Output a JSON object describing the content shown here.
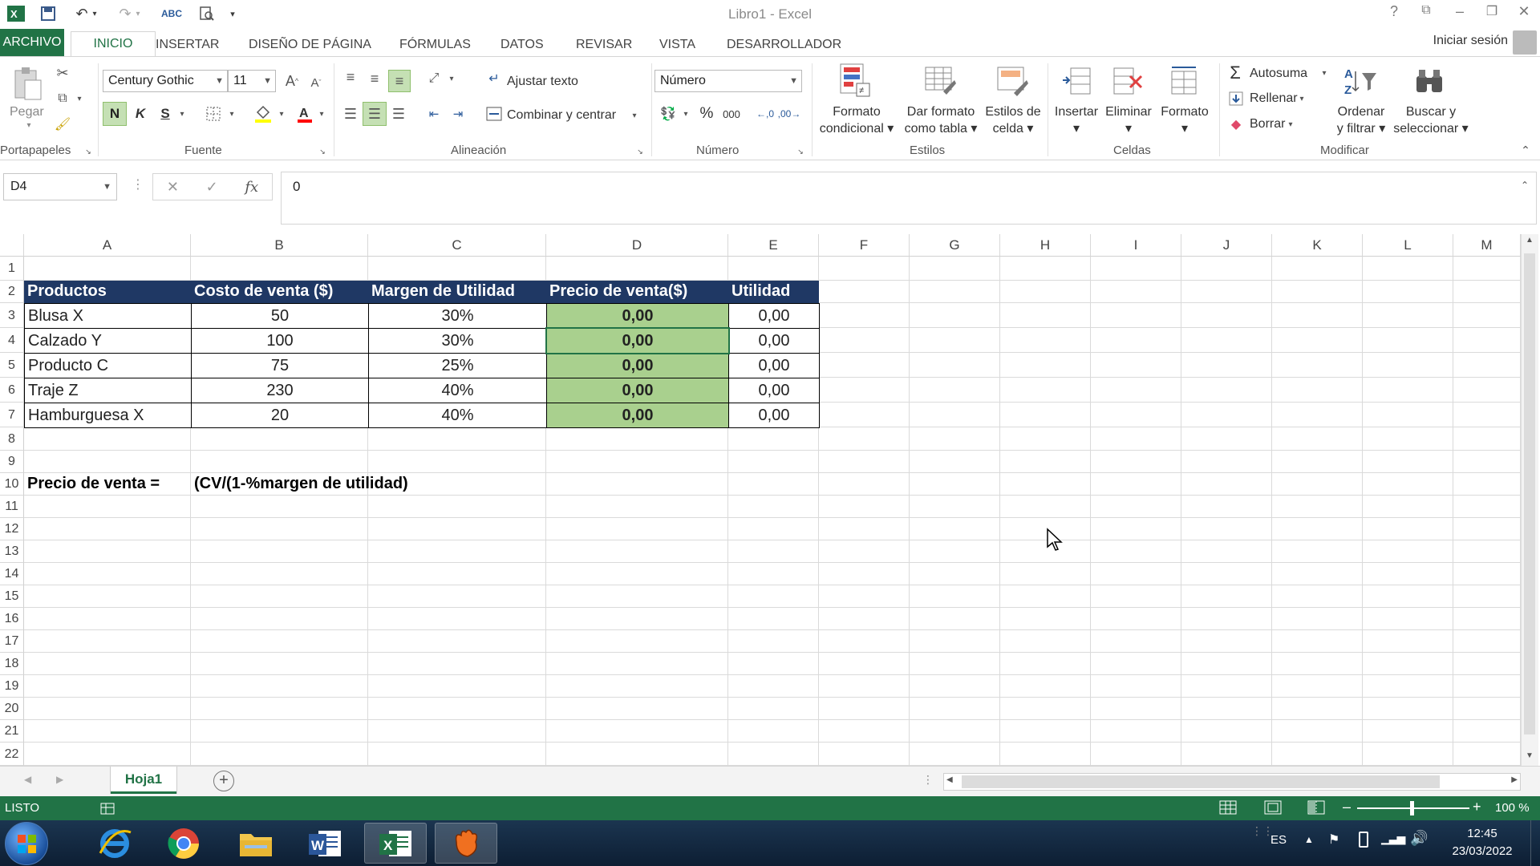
{
  "window": {
    "title": "Libro1 - Excel",
    "help": "?",
    "ribbon_display": "⧉",
    "minimize": "–",
    "restore": "❐",
    "close": "✕"
  },
  "qat": {
    "excel_icon": "excel-logo",
    "save": "save-icon",
    "undo": "undo-icon",
    "redo": "redo-icon",
    "spelling": "spelling-icon",
    "print_preview": "print-preview-icon",
    "customize": "▾"
  },
  "tabs": [
    "ARCHIVO",
    "INICIO",
    "INSERTAR",
    "DISEÑO DE PÁGINA",
    "FÓRMULAS",
    "DATOS",
    "REVISAR",
    "VISTA",
    "DESARROLLADOR"
  ],
  "signin": "Iniciar sesión",
  "ribbon": {
    "clipboard": {
      "paste": "Pegar",
      "label": "Portapapeles"
    },
    "font": {
      "name": "Century Gothic",
      "size": "11",
      "bold": "N",
      "italic": "K",
      "underline": "S",
      "label": "Fuente"
    },
    "alignment": {
      "wrap": "Ajustar texto",
      "merge": "Combinar y centrar",
      "label": "Alineación"
    },
    "number": {
      "format": "Número",
      "percent": "%",
      "thousands": "000",
      "label": "Número"
    },
    "styles": {
      "conditional": [
        "Formato",
        "condicional"
      ],
      "table": [
        "Dar formato",
        "como tabla"
      ],
      "cell": [
        "Estilos de",
        "celda"
      ],
      "label": "Estilos"
    },
    "cells": {
      "insert": "Insertar",
      "delete": "Eliminar",
      "format": "Formato",
      "label": "Celdas"
    },
    "editing": {
      "autosum": "Autosuma",
      "fill": "Rellenar",
      "clear": "Borrar",
      "sort": [
        "Ordenar",
        "y filtrar"
      ],
      "find": [
        "Buscar y",
        "seleccionar"
      ],
      "label": "Modificar"
    }
  },
  "formula_bar": {
    "name_box": "D4",
    "fx": "fx",
    "cancel": "✕",
    "enter": "✓",
    "value": "0"
  },
  "columns": [
    "A",
    "B",
    "C",
    "D",
    "E",
    "F",
    "G",
    "H",
    "I",
    "J",
    "K",
    "L",
    "M"
  ],
  "rows": [
    "1",
    "2",
    "3",
    "4",
    "5",
    "6",
    "7",
    "8",
    "9",
    "10",
    "11",
    "12",
    "13",
    "14",
    "15",
    "16",
    "17",
    "18",
    "19",
    "20",
    "21",
    "22"
  ],
  "table": {
    "headers": [
      "Productos",
      "Costo de venta ($)",
      "Margen de Utilidad",
      "Precio de venta($)",
      "Utilidad"
    ],
    "rows": [
      [
        "Blusa X",
        "50",
        "30%",
        "0,00",
        "0,00"
      ],
      [
        "Calzado Y",
        "100",
        "30%",
        "0,00",
        "0,00"
      ],
      [
        "Producto C",
        "75",
        "25%",
        "0,00",
        "0,00"
      ],
      [
        "Traje Z",
        "230",
        "40%",
        "0,00",
        "0,00"
      ],
      [
        "Hamburguesa X",
        "20",
        "40%",
        "0,00",
        "0,00"
      ]
    ]
  },
  "note": {
    "label": "Precio de venta =",
    "formula": "(CV/(1-%margen de utilidad)"
  },
  "sheets": {
    "active": "Hoja1",
    "add": "+"
  },
  "status": {
    "mode": "LISTO",
    "zoom": "100 %",
    "minus": "–",
    "plus": "+"
  },
  "taskbar": {
    "lang": "ES",
    "time": "12:45",
    "date": "23/03/2022"
  },
  "colors": {
    "accent": "#217346",
    "header_fill": "#1f3864",
    "result_fill": "#a9d08e"
  }
}
